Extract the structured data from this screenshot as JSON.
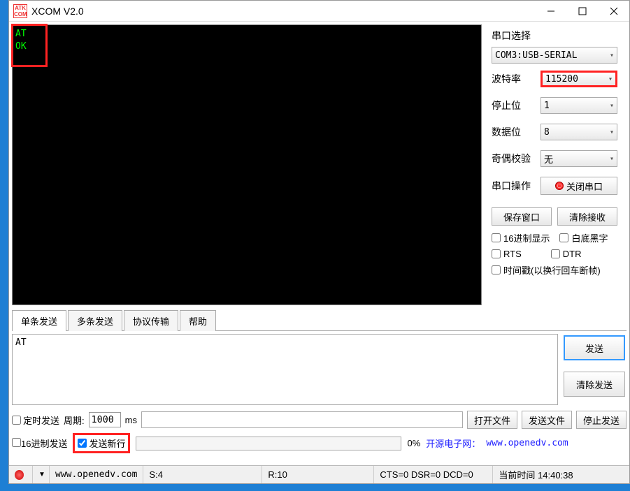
{
  "window": {
    "title": "XCOM V2.0",
    "logo_text": "ATK\nCOM"
  },
  "terminal": {
    "lines": [
      "AT",
      "",
      "OK"
    ]
  },
  "serial": {
    "section_label": "串口选择",
    "port": "COM3:USB-SERIAL",
    "baud_label": "波特率",
    "baud_value": "115200",
    "stopbits_label": "停止位",
    "stopbits_value": "1",
    "databits_label": "数据位",
    "databits_value": "8",
    "parity_label": "奇偶校验",
    "parity_value": "无",
    "op_label": "串口操作",
    "op_button": "关闭串口"
  },
  "buttons": {
    "save_window": "保存窗口",
    "clear_recv": "清除接收",
    "hex_display": "16进制显示",
    "white_bg": "白底黑字",
    "rts": "RTS",
    "dtr": "DTR",
    "timestamp": "时间戳(以换行回车断帧)"
  },
  "tabs": {
    "single": "单条发送",
    "multi": "多条发送",
    "protocol": "协议传输",
    "help": "帮助"
  },
  "send": {
    "input_value": "AT",
    "send_btn": "发送",
    "clear_send_btn": "清除发送",
    "timed_send": "定时发送",
    "period_label": "周期:",
    "period_value": "1000",
    "period_unit": "ms",
    "open_file": "打开文件",
    "send_file": "发送文件",
    "stop_send": "停止发送",
    "hex_send": "16进制发送",
    "send_newline": "发送新行",
    "progress": "0%",
    "link_prefix": "开源电子网：",
    "link_url": "www.openedv.com"
  },
  "status": {
    "url": "www.openedv.com",
    "s": "S:4",
    "r": "R:10",
    "cts": "CTS=0 DSR=0 DCD=0",
    "time_label": "当前时间 14:40:38"
  },
  "watermark": ""
}
